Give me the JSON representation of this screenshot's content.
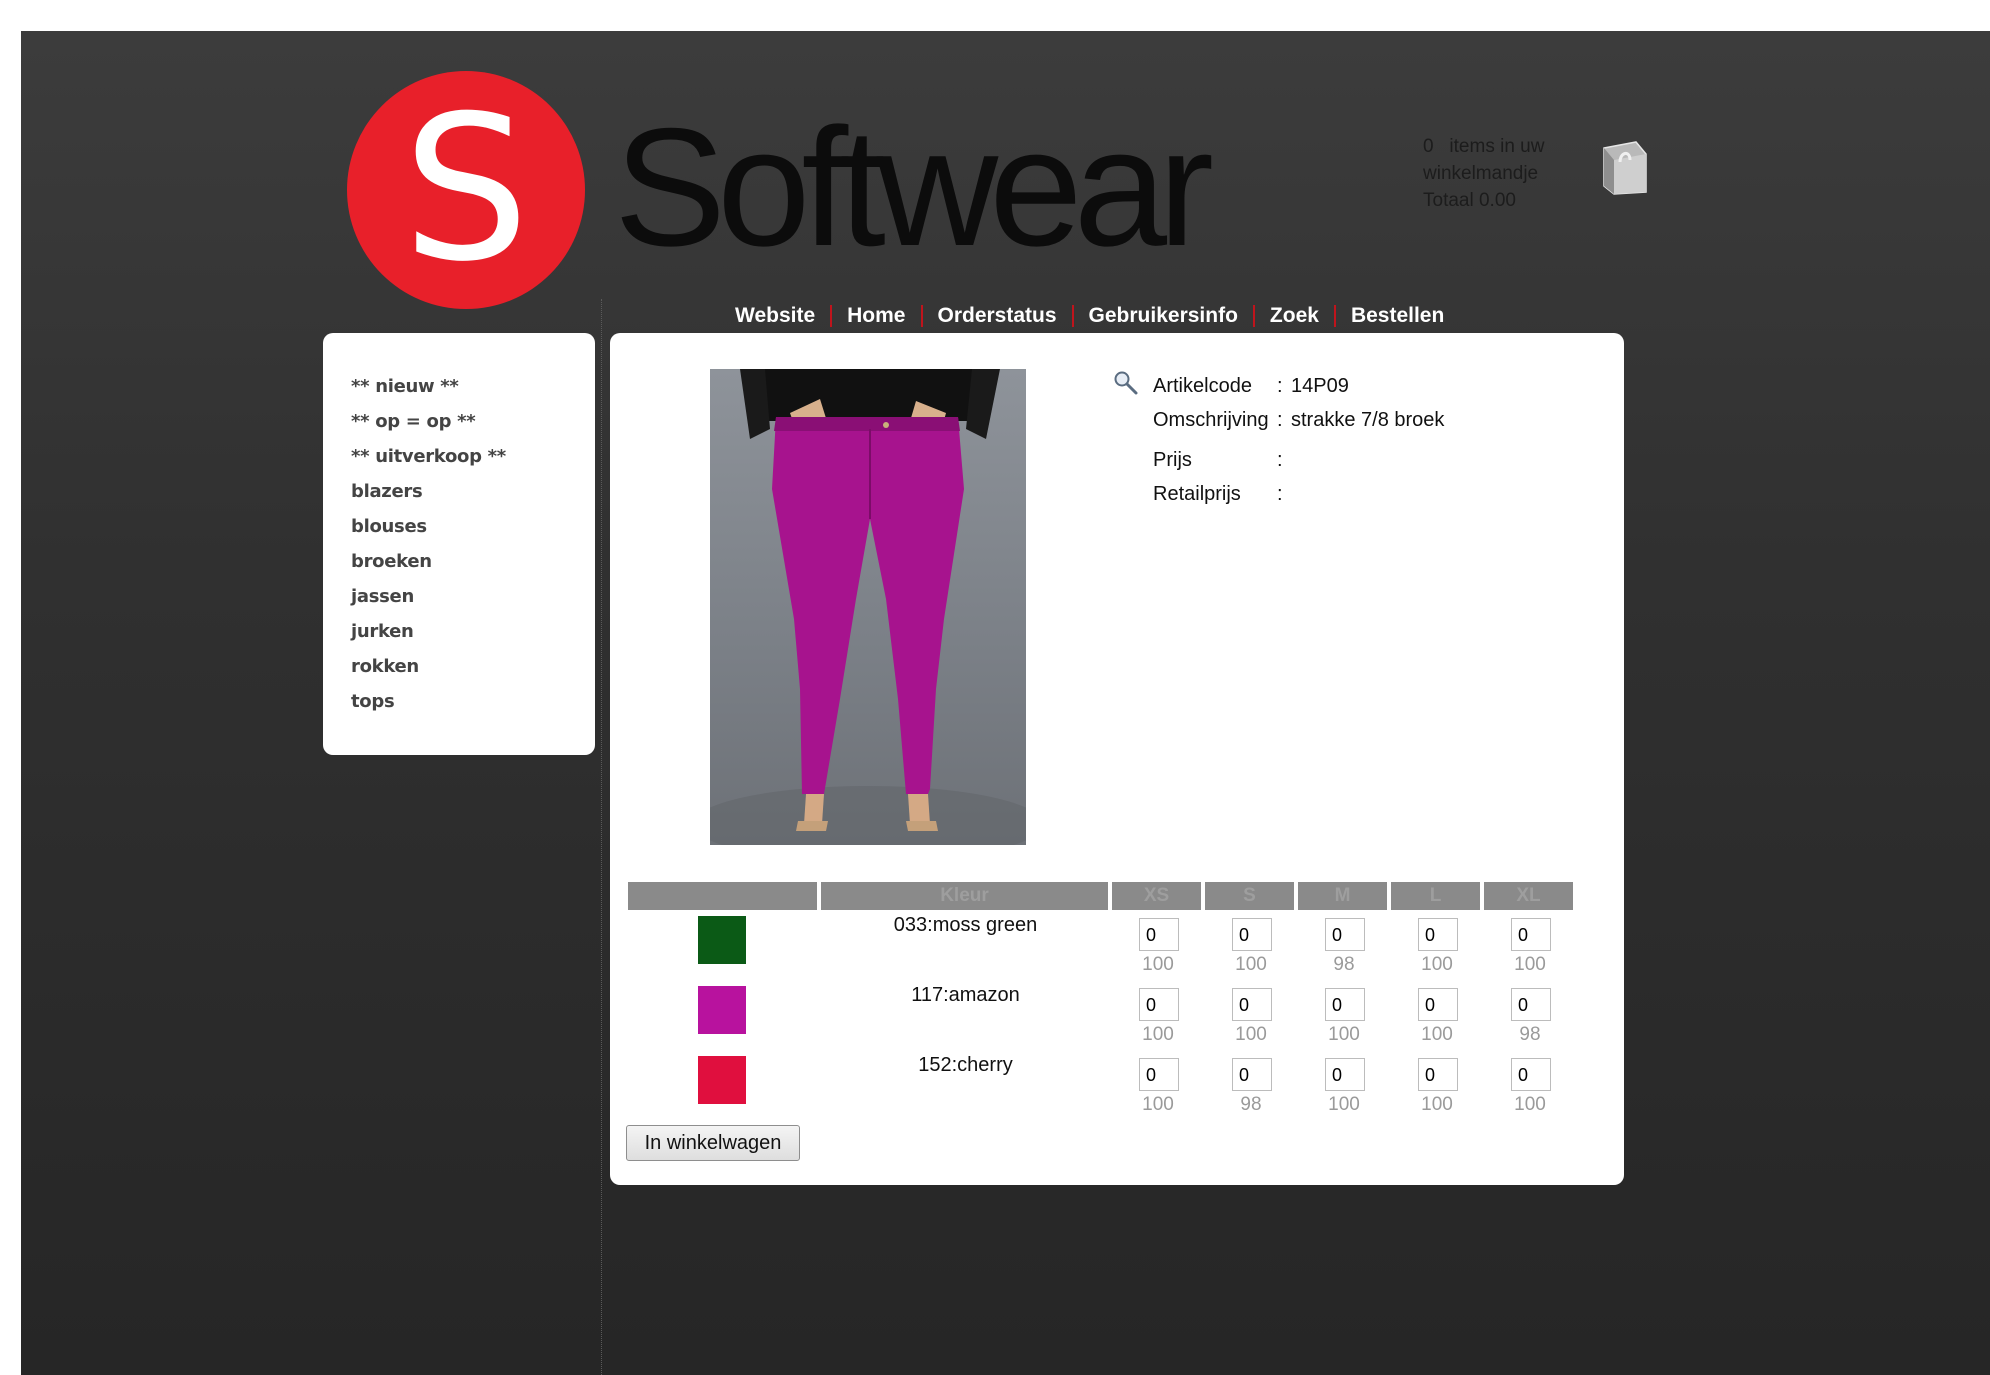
{
  "brand": {
    "logo_letter": "S",
    "name": "Softwear",
    "logo_color": "#e8202a"
  },
  "cart": {
    "count": "0",
    "line1": "items in uw",
    "line2": "winkelmandje",
    "total_label": "Totaal",
    "total_value": "0.00",
    "icon": "shopping-bag-icon"
  },
  "nav": {
    "items": [
      "Website",
      "Home",
      "Orderstatus",
      "Gebruikersinfo",
      "Zoek",
      "Bestellen"
    ],
    "separator_color": "#c0141c"
  },
  "sidebar": {
    "items": [
      "** nieuw **",
      "** op = op **",
      "** uitverkoop **",
      "blazers",
      "blouses",
      "broeken",
      "jassen",
      "jurken",
      "rokken",
      "tops"
    ]
  },
  "product": {
    "image": "magenta skinny jeans photo",
    "zoom_icon": "magnifier-icon",
    "code_label": "Artikelcode",
    "code": "14P09",
    "description_label": "Omschrijving",
    "description": "strakke 7/8 broek",
    "price_label": "Prijs",
    "price": "",
    "retail_label": "Retailprijs",
    "retail": "",
    "separator": ":"
  },
  "variants": {
    "header": {
      "color": "Kleur",
      "sizes": [
        "XS",
        "S",
        "M",
        "L",
        "XL"
      ]
    },
    "rows": [
      {
        "swatch": "#0b5a16",
        "name": "033:moss green",
        "qty": [
          "0",
          "0",
          "0",
          "0",
          "0"
        ],
        "stock": [
          "100",
          "100",
          "98",
          "100",
          "100"
        ]
      },
      {
        "swatch": "#b8129e",
        "name": "117:amazon",
        "qty": [
          "0",
          "0",
          "0",
          "0",
          "0"
        ],
        "stock": [
          "100",
          "100",
          "100",
          "100",
          "98"
        ]
      },
      {
        "swatch": "#e00f3e",
        "name": "152:cherry",
        "qty": [
          "0",
          "0",
          "0",
          "0",
          "0"
        ],
        "stock": [
          "100",
          "98",
          "100",
          "100",
          "100"
        ]
      }
    ]
  },
  "actions": {
    "add_to_cart": "In winkelwagen"
  }
}
